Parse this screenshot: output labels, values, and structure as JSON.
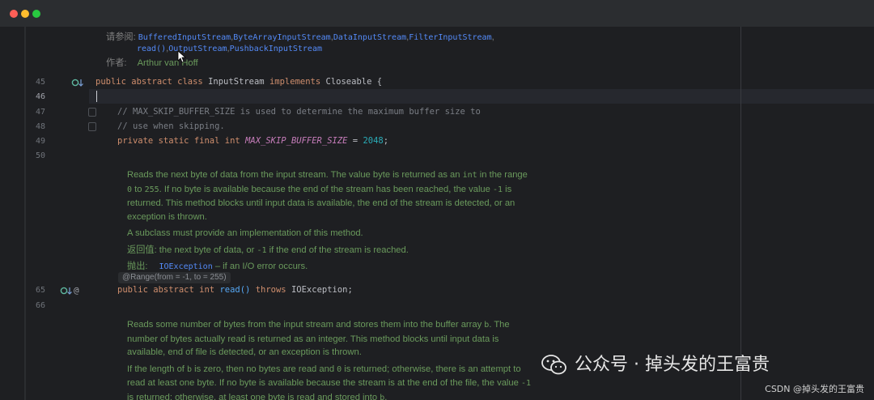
{
  "javadoc_header": {
    "see_label": "请参阅:",
    "see_links_line1": [
      "BufferedInputStream",
      "ByteArrayInputStream",
      "DataInputStream",
      "FilterInputStream"
    ],
    "see_links_line2": [
      "read()",
      "OutputStream",
      "PushbackInputStream"
    ],
    "author_label": "作者:",
    "author_value": "Arthur van Hoff"
  },
  "line_numbers": [
    "45",
    "46",
    "47",
    "48",
    "49",
    "50",
    "65",
    "66"
  ],
  "code": {
    "l45_kw": "public abstract class",
    "l45_name": "InputStream",
    "l45_kw2": "implements",
    "l45_rest": "Closeable {",
    "l47": "// MAX_SKIP_BUFFER_SIZE is used to determine the maximum buffer size to",
    "l48": "// use when skipping.",
    "l49_kw": "private static final int",
    "l49_const": "MAX_SKIP_BUFFER_SIZE",
    "l49_eq": " = ",
    "l49_num": "2048",
    "l49_end": ";",
    "l65_kw": "public abstract int",
    "l65_name": "read()",
    "l65_kw2": "throws",
    "l65_rest": "IOException;"
  },
  "doc_read": {
    "p1_a": "Reads the next byte of data from the input stream. The value byte is returned as an ",
    "p1_int": "int",
    "p1_b": " in the range",
    "p1_c0": "0",
    "p1_c1": " to ",
    "p1_c2": "255",
    "p1_c3": ". If no byte is available because the end of the stream has been reached, the value ",
    "p1_c4": "-1",
    "p1_c5": " is",
    "p1_d": "returned. This method blocks until input data is available, the end of the stream is detected, or an",
    "p1_e": "exception is thrown.",
    "p2": "A subclass must provide an implementation of this method.",
    "returns_label": "返回值:",
    "returns_a": " the next byte of data, or ",
    "returns_m1": "-1",
    "returns_b": " if the end of the stream is reached.",
    "throws_label": "抛出:",
    "throws_link": "IOException",
    "throws_text": " – if an I/O error occurs."
  },
  "annotation": "@Range(from = -1, to = 255)",
  "doc_read_b": {
    "p1_a": "Reads some number of bytes from the input stream and stores them into the buffer array ",
    "p1_b": "b",
    "p1_c": ". The",
    "p1_d": "number of bytes actually read is returned as an integer. This method blocks until input data is",
    "p1_e": "available, end of file is detected, or an exception is thrown.",
    "p2_a": "If the length of ",
    "p2_b": "b",
    "p2_c": " is zero, then no bytes are read and ",
    "p2_d": "0",
    "p2_e": " is returned; otherwise, there is an attempt to",
    "p2_f": "read at least one byte. If no byte is available because the stream is at the end of the file, the value ",
    "p2_g": "-1",
    "p2_h": "is returned; otherwise, at least one byte is read and stored into ",
    "p2_i": "b",
    "p2_j": "."
  },
  "watermark": "公众号 · 掉头发的王富贵",
  "credit": "CSDN @掉头发的王富贵",
  "colors": {
    "keyword": "#cf8e6d",
    "comment": "#7a7e85",
    "constant": "#c77dbb",
    "number": "#2aacb8",
    "doc_text": "#6a9a5c",
    "link": "#548af7"
  },
  "icons": [
    "override-marker-icon",
    "implemented-marker-icon",
    "annotation-icon",
    "fold-icon",
    "wechat-icon",
    "mouse-cursor-icon"
  ]
}
